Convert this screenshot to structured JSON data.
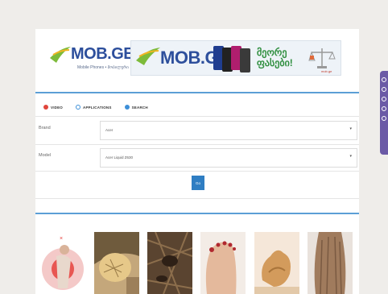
{
  "header": {
    "logo_text": "MOB.GE",
    "logo_tagline": "Mobile Phones • მობილური",
    "banner": {
      "brand": "MOB.GE",
      "slogan_line1": "მეორე",
      "slogan_line2": "ფასები!",
      "footer": "mob.ge"
    }
  },
  "tabs": [
    {
      "label": "VIDEO",
      "icon": "video-icon"
    },
    {
      "label": "APPLICATIONS",
      "icon": "applications-icon"
    },
    {
      "label": "SEARCH",
      "icon": "search-icon"
    }
  ],
  "form": {
    "brand_label": "Brand",
    "brand_value": "Acer",
    "model_label": "Model",
    "model_value": "Acer Liquid Z630",
    "go_label": "Go"
  },
  "thumbnails": [
    {
      "name": "thumbnail-woman-back-pain",
      "colors": [
        "#f4d0cf",
        "#e53935"
      ]
    },
    {
      "name": "thumbnail-heel-skin",
      "colors": [
        "#b69a68",
        "#8f7a4e"
      ]
    },
    {
      "name": "thumbnail-pests",
      "colors": [
        "#7a5a3c",
        "#3c2a1a"
      ]
    },
    {
      "name": "thumbnail-foot",
      "colors": [
        "#e8c3a8",
        "#c28f74"
      ]
    },
    {
      "name": "thumbnail-ginger",
      "colors": [
        "#e7b88a",
        "#b9854d"
      ]
    },
    {
      "name": "thumbnail-hair",
      "colors": [
        "#b89175",
        "#7a5a44"
      ]
    }
  ],
  "colors": {
    "accent_blue": "#5c9fd6",
    "button_blue": "#2f7ec3",
    "side_widget": "#6b5aa6"
  }
}
